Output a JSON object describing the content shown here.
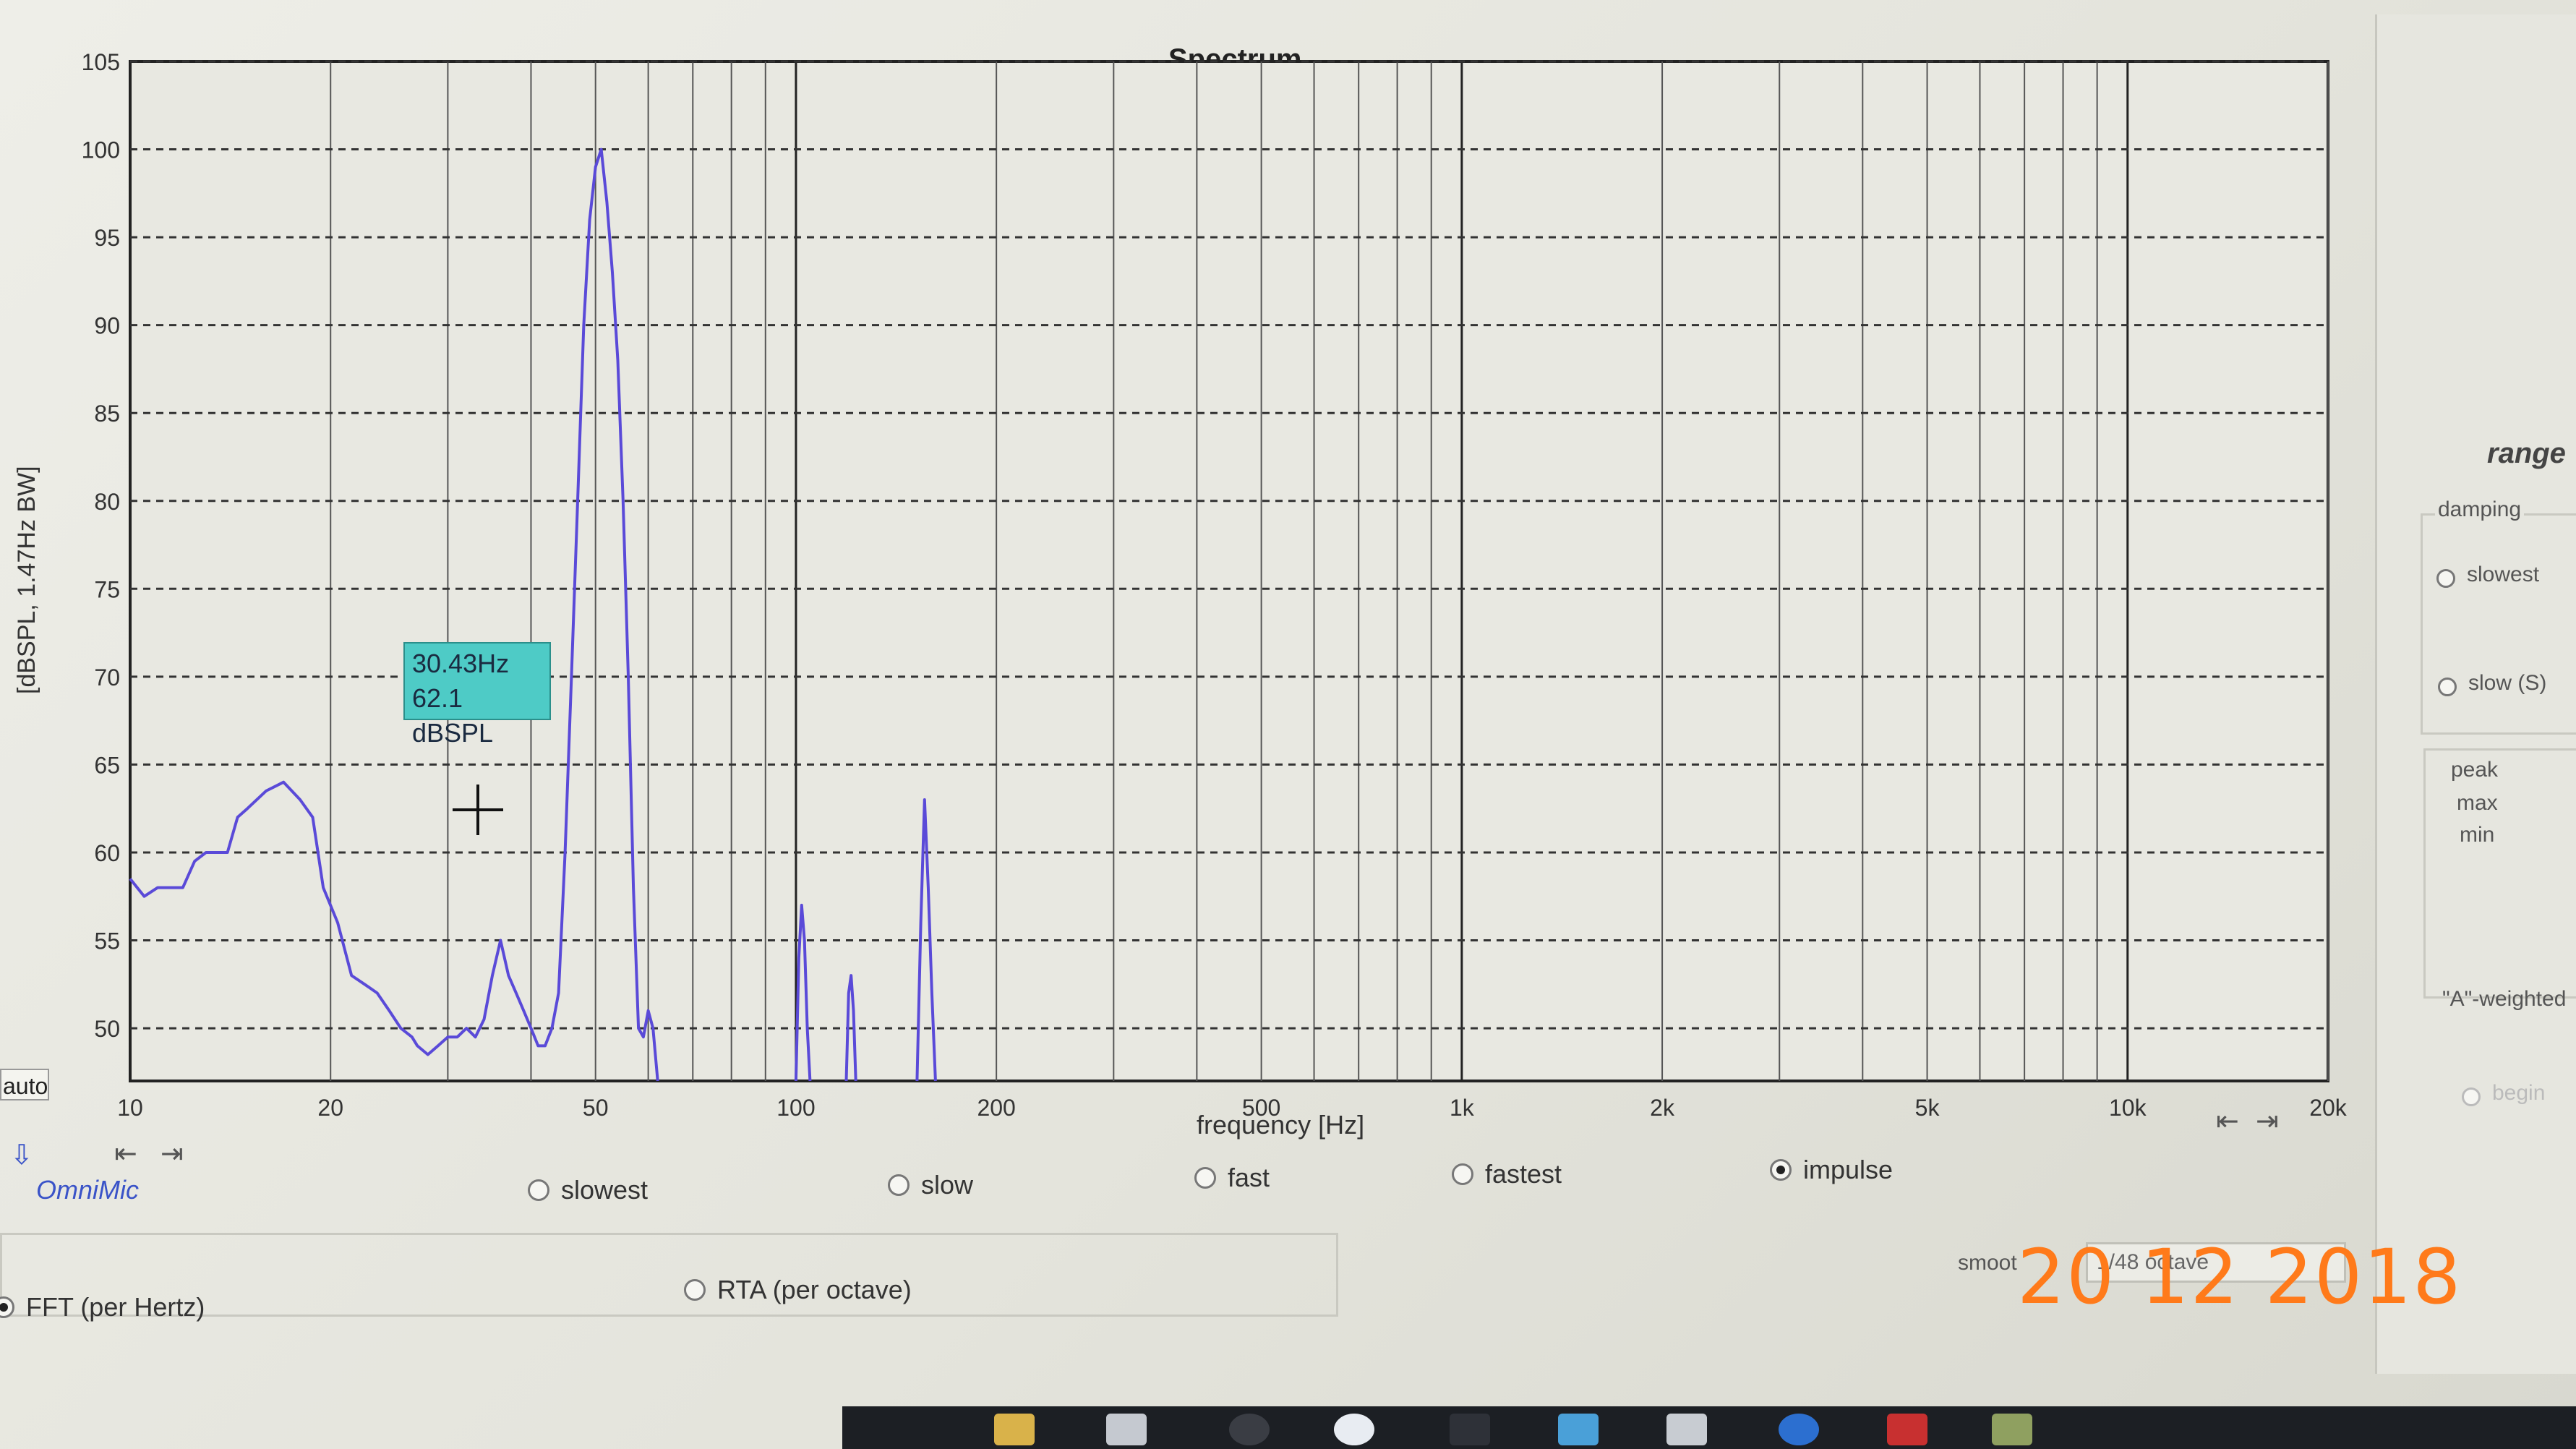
{
  "chart_data": {
    "type": "line",
    "title": "Spectrum",
    "xlabel": "frequency [Hz]",
    "ylabel": "[dBSPL, 1.47Hz BW]",
    "x_scale": "log",
    "xlim": [
      10,
      20000
    ],
    "ylim": [
      47,
      105
    ],
    "grid": true,
    "x_ticks": [
      {
        "v": 10,
        "label": "10"
      },
      {
        "v": 20,
        "label": "20"
      },
      {
        "v": 50,
        "label": "50"
      },
      {
        "v": 100,
        "label": "100"
      },
      {
        "v": 200,
        "label": "200"
      },
      {
        "v": 500,
        "label": "500"
      },
      {
        "v": 1000,
        "label": "1k"
      },
      {
        "v": 2000,
        "label": "2k"
      },
      {
        "v": 5000,
        "label": "5k"
      },
      {
        "v": 10000,
        "label": "10k"
      },
      {
        "v": 20000,
        "label": "20k"
      }
    ],
    "y_ticks": [
      50,
      55,
      60,
      65,
      70,
      75,
      80,
      85,
      90,
      95,
      100,
      105
    ],
    "series": [
      {
        "color": "#5a4ad8",
        "segments": [
          [
            [
              10,
              58.5
            ],
            [
              10.5,
              57.5
            ],
            [
              11,
              58
            ],
            [
              12,
              58
            ],
            [
              12.5,
              59.5
            ],
            [
              13,
              60
            ],
            [
              14,
              60
            ],
            [
              14.5,
              62
            ],
            [
              15,
              62.5
            ],
            [
              16,
              63.5
            ],
            [
              17,
              64
            ],
            [
              18,
              63
            ],
            [
              18.8,
              62
            ],
            [
              19.5,
              58
            ],
            [
              20.5,
              56
            ],
            [
              21.5,
              53
            ],
            [
              22.5,
              52.5
            ],
            [
              23.5,
              52
            ],
            [
              24.5,
              51
            ],
            [
              25.5,
              50
            ],
            [
              26.5,
              49.5
            ],
            [
              27,
              49
            ],
            [
              28,
              48.5
            ],
            [
              29,
              49
            ],
            [
              30,
              49.5
            ],
            [
              31,
              49.5
            ],
            [
              32,
              50
            ],
            [
              33,
              49.5
            ],
            [
              34,
              50.5
            ],
            [
              35,
              53
            ],
            [
              36,
              55
            ],
            [
              37,
              53
            ],
            [
              38,
              52
            ],
            [
              39,
              51
            ],
            [
              40,
              50
            ],
            [
              41,
              49
            ],
            [
              42,
              49
            ],
            [
              43,
              50
            ],
            [
              44,
              52
            ],
            [
              45,
              60
            ],
            [
              46,
              70
            ],
            [
              47,
              80
            ],
            [
              48,
              90
            ],
            [
              49,
              96
            ],
            [
              50,
              99
            ],
            [
              51,
              100
            ],
            [
              52,
              97
            ],
            [
              53,
              93
            ],
            [
              54,
              88
            ],
            [
              55,
              80
            ],
            [
              56,
              70
            ],
            [
              57,
              58
            ],
            [
              58,
              50
            ],
            [
              59,
              49.5
            ],
            [
              60,
              51
            ],
            [
              61,
              50
            ],
            [
              62,
              47
            ]
          ],
          [
            [
              100,
              47
            ],
            [
              101,
              54
            ],
            [
              102,
              57
            ],
            [
              103,
              55
            ],
            [
              104,
              50
            ],
            [
              105,
              47
            ]
          ],
          [
            [
              119,
              47
            ],
            [
              120,
              52
            ],
            [
              121,
              53
            ],
            [
              122,
              51
            ],
            [
              123,
              47
            ]
          ],
          [
            [
              152,
              47
            ],
            [
              154,
              56
            ],
            [
              156,
              63
            ],
            [
              158,
              58
            ],
            [
              160,
              52
            ],
            [
              162,
              47
            ]
          ]
        ]
      }
    ],
    "cursor": {
      "x": 30.43,
      "y": 62.1
    }
  },
  "tooltip": {
    "freq": "30.43Hz",
    "level": "62.1 dBSPL"
  },
  "controls": {
    "auto_label": "auto",
    "app_name": "OmniMic",
    "damping_options": [
      {
        "label": "slowest",
        "selected": false
      },
      {
        "label": "slow",
        "selected": false
      },
      {
        "label": "fast",
        "selected": false
      },
      {
        "label": "fastest",
        "selected": false
      },
      {
        "label": "impulse",
        "selected": true
      }
    ],
    "mode_options": [
      {
        "label": "FFT (per Hertz)",
        "selected": true
      },
      {
        "label": "RTA (per octave)",
        "selected": false
      }
    ],
    "smoothing_label": "smoot",
    "smoothing_value": "1/48  octave"
  },
  "right_panel": {
    "range_label": "range",
    "damping_title": "damping",
    "damping_options": [
      "slowest",
      "slow (S)"
    ],
    "hold_options": [
      "peak",
      "max",
      "min"
    ],
    "a_weighted": "\"A\"-weighted",
    "begin": "begin"
  },
  "date_stamp": "20 12 2018",
  "colors": {
    "trace": "#5a4ad8",
    "tooltip_bg": "#4ecbc6",
    "date_stamp": "#ff7a1a"
  }
}
